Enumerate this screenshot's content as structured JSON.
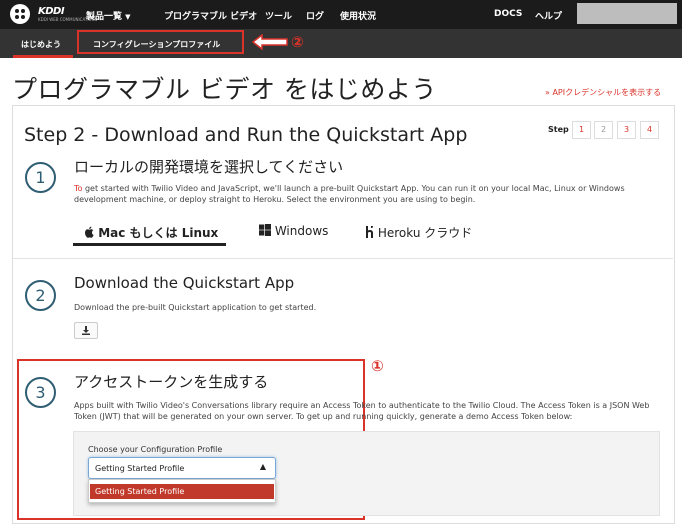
{
  "topbar": {
    "brand": "KDDI",
    "brand_sub": "KDDI WEB COMMUNICATIONS",
    "products_label": "製品一覧",
    "nav": [
      "プログラマブル ビデオ",
      "ツール",
      "ログ",
      "使用状況"
    ],
    "docs": "DOCS",
    "help": "ヘルプ"
  },
  "subnav": {
    "tabs": [
      "はじめよう",
      "コンフィグレーションプロファイル"
    ]
  },
  "annotations": {
    "one": "①",
    "two": "②"
  },
  "page": {
    "title": "プログラマブル ビデオ をはじめよう",
    "api_link": "APIクレデンシャルを表示する"
  },
  "step": {
    "title": "Step 2 - Download and Run the Quickstart App",
    "label": "Step",
    "pages": [
      "1",
      "2",
      "3",
      "4"
    ]
  },
  "section1": {
    "number": "1",
    "title": "ローカルの開発環境を選択してください",
    "text_highlight": "To",
    "text": " get started with Twilio Video and JavaScript, we'll launch a pre-built Quickstart App. You can run it on your local Mac, Linux or Windows development machine, or deploy straight to Heroku. Select the environment you are using to begin.",
    "tabs": [
      "Mac もしくは Linux",
      "Windows",
      "Heroku クラウド"
    ]
  },
  "section2": {
    "number": "2",
    "title": "Download the Quickstart App",
    "text": "Download the pre-built Quickstart application to get started."
  },
  "section3": {
    "number": "3",
    "title": "アクセストークンを生成する",
    "text": "Apps built with Twilio Video's Conversations library require an Access Token to authenticate to the Twilio Cloud. The Access Token is a JSON Web Token (JWT) that will be generated on your own server. To get up and running quickly, generate a demo Access Token below:",
    "config_label": "Choose your Configuration Profile",
    "select_value": "Getting Started Profile",
    "dropdown_option": "Getting Started Profile"
  },
  "colors": {
    "accent": "#d9332a",
    "topbar": "#1b1b1b",
    "subbar": "#333333",
    "circle": "#2f5d73"
  }
}
